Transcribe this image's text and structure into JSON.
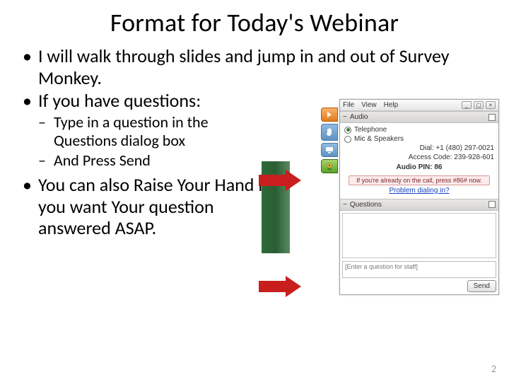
{
  "title": "Format for Today's Webinar",
  "bullets": {
    "b1": "I will walk through slides and jump in and out of Survey Monkey.",
    "b2": "If you have questions:",
    "s1": "Type in a question in the Questions dialog box",
    "s2": "And Press Send",
    "b3": "You can also Raise Your Hand if you want Your question answered ASAP."
  },
  "panel": {
    "menu": {
      "file": "File",
      "view": "View",
      "help": "Help"
    },
    "sections": {
      "audio": "Audio",
      "questions": "Questions"
    },
    "audio": {
      "opt_telephone": "Telephone",
      "opt_mic": "Mic & Speakers",
      "dial_label": "Dial:",
      "dial_value": "+1 (480) 297-0021",
      "access_label": "Access Code:",
      "access_value": "239-928-601",
      "pin_label": "Audio PIN:",
      "pin_value": "86",
      "notice": "If you're already on the call, press #86# now.",
      "problem": "Problem dialing in?"
    },
    "questions": {
      "placeholder": "[Enter a question for staff]",
      "send": "Send"
    }
  },
  "slide_number": "2"
}
